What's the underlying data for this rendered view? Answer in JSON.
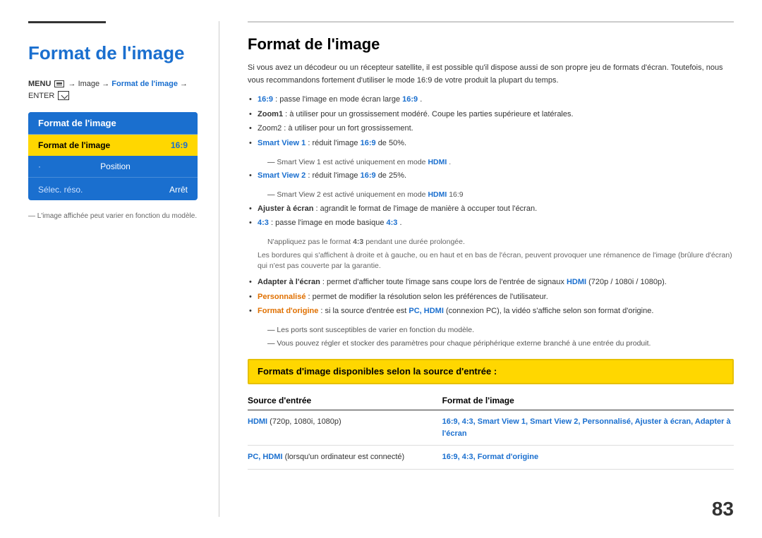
{
  "left": {
    "title": "Format de l'image",
    "menu_path_before": "MENU",
    "menu_path_image": "Image",
    "menu_path_arrow1": "→",
    "menu_path_highlight": "Format de l'image",
    "menu_path_arrow2": "→",
    "menu_path_enter": "ENTER",
    "tv_menu": {
      "title": "Format de l'image",
      "items": [
        {
          "label": "Format de l'image",
          "value": "16:9",
          "selected": true
        },
        {
          "label": "Position",
          "value": "",
          "selected": false,
          "dot": true
        },
        {
          "label": "Sélec. réso.",
          "value": "Arrêt",
          "selected": false
        }
      ]
    },
    "footnote": "L'image affichée peut varier en fonction du modèle."
  },
  "right": {
    "title": "Format de l'image",
    "intro": "Si vous avez un décodeur ou un récepteur satellite, il est possible qu'il dispose aussi de son propre jeu de formats d'écran. Toutefois, nous vous recommandons fortement d'utiliser le mode 16:9 de votre produit la plupart du temps.",
    "bullets": [
      {
        "text_before": "",
        "bold_blue": "16:9",
        "text_after": " : passe l'image en mode écran large ",
        "bold_blue2": "16:9",
        "text_end": "."
      },
      {
        "bold": "Zoom1",
        "text_after": " : à utiliser pour un grossissement modéré. Coupe les parties supérieure et latérales."
      },
      {
        "text": "Zoom2 : à utiliser pour un fort grossissement."
      },
      {
        "bold_blue": "Smart View 1",
        "text_after": " : réduit l'image ",
        "bold_blue2": "16:9",
        "text_end": " de 50%."
      },
      {
        "sub_note": "Smart View 1 est activé uniquement en mode HDMI."
      },
      {
        "bold_blue": "Smart View 2",
        "text_after": " : réduit l'image ",
        "bold_blue2": "16:9",
        "text_end": " de 25%."
      },
      {
        "sub_note": "Smart View 2 est activé uniquement en mode HDMI 16:9"
      },
      {
        "bold": "Ajuster à écran",
        "text_after": " : agrandit le format de l'image de manière à occuper tout l'écran."
      },
      {
        "bold_blue": "4:3",
        "text_after": " : passe l'image en mode basique ",
        "bold_blue2": "4:3",
        "text_end": "."
      },
      {
        "warning": "N'appliquez pas le format 4:3 pendant une durée prolongée."
      },
      {
        "warning_border": "Les bordures qui s'affichent à droite et à gauche, ou en haut et en bas de l'écran, peuvent provoquer une rémanence de l'image (brûlure d'écran) qui n'est pas couverte par la garantie."
      },
      {
        "bold": "Adapter à l'écran",
        "text_after": " : permet d'afficher toute l'image sans coupe lors de l'entrée de signaux ",
        "bold_blue": "HDMI",
        "text_end": "(720p / 1080i / 1080p)."
      },
      {
        "bold_orange": "Personnalisé",
        "text_after": " : permet de modifier la résolution selon les préférences de l'utilisateur."
      },
      {
        "bold_orange": "Format d'origine",
        "text_after": " : si la source d'entrée est ",
        "bold_blue": "PC, HDMI",
        "text_end": "(connexion PC), la vidéo s'affiche selon son format d'origine."
      },
      {
        "sub_note2": "Les ports sont susceptibles de varier en fonction du modèle."
      },
      {
        "sub_note2": "Vous pouvez régler et stocker des paramètres pour chaque périphérique externe branché à une entrée du produit."
      }
    ],
    "section_title": "Formats d'image disponibles selon la source d'entrée :",
    "table": {
      "col1_header": "Source d'entrée",
      "col2_header": "Format de l'image",
      "rows": [
        {
          "source": "HDMI (720p, 1080i, 1080p)",
          "source_blue": "HDMI",
          "source_rest": " (720p, 1080i, 1080p)",
          "format": "16:9, 4:3, Smart View 1, Smart View 2, Personnalisé, Ajuster à écran, Adapter à l'écran"
        },
        {
          "source": "PC, HDMI(lorsqu'un ordinateur est connecté)",
          "source_blue1": "PC,",
          "source_blue2": "HDMI",
          "source_rest": "(lorsqu'un ordinateur est connecté)",
          "format": "16:9, 4:3, Format d'origine"
        }
      ]
    }
  },
  "page_number": "83"
}
